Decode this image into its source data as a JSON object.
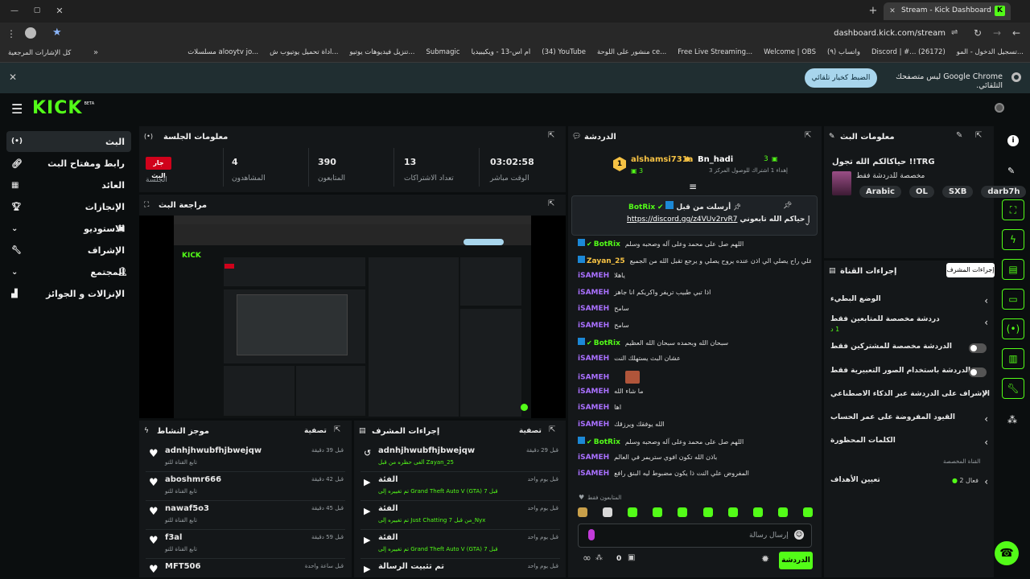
{
  "browser": {
    "tab_title": "Stream - Kick Dashboard",
    "url": "dashboard.kick.com/stream",
    "bookmarks": [
      "تسجيل الدخول - المو...",
      "Discord | #... (26172)",
      "(٩) واتساب",
      "Welcome | OBS",
      "Free Live Streaming...",
      "منشور على اللوحة ce...",
      "(34) YouTube",
      "أم أس-13 - ويكيبيديا",
      "Submagic",
      "تنزيل فيديوهات يوتيو...",
      "أداة تحميل يوتيوب ش...",
      "مسلسلات alooytv jo...",
      "كل الإشارات المرجعية"
    ],
    "info_text": "Google Chrome ليس متصفحك التلقائي.",
    "info_button": "الضبط كخيار تلقائي"
  },
  "nav": {
    "logo": "KICK",
    "logo_sup": "BETA",
    "items": [
      "البث",
      "رابط ومفتاح البث",
      "العائد",
      "الإنجازات",
      "الاستوديو",
      "الإشراف",
      "المجتمع",
      "الإنزالات و الجوائز"
    ]
  },
  "session": {
    "title": "معلومات الجلسة",
    "live_badge": "جار البث",
    "session_label": "الجلسة",
    "viewers_value": "4",
    "viewers_label": "المشاهدون",
    "followers_value": "390",
    "followers_label": "المتابعون",
    "subs_value": "13",
    "subs_label": "تعداد الاشتراكات",
    "time_value": "03:02:58",
    "time_label": "الوقت مباشر"
  },
  "preview": {
    "title": "مراجعة البث"
  },
  "activity": {
    "title": "موجز النشاط",
    "filter": "تصفية",
    "items": [
      {
        "name": "adnhjhwubfhjbwejqw",
        "sub": "تابع القناة للتو",
        "time": "قبل 39 دقيقة"
      },
      {
        "name": "aboshmr666",
        "sub": "تابع القناة للتو",
        "time": "قبل 42 دقيقة"
      },
      {
        "name": "nawaf5o3",
        "sub": "تابع القناة للتو",
        "time": "قبل 45 دقيقة"
      },
      {
        "name": "f3al",
        "sub": "تابع القناة للتو",
        "time": "قبل 59 دقيقة"
      },
      {
        "name": "MFT506",
        "sub": "",
        "time": "قبل ساعة واحدة"
      }
    ]
  },
  "modactions": {
    "title": "إجراءات المشرف",
    "filter": "تصفية",
    "items": [
      {
        "name": "adnhjhwubfhjbwejqw",
        "sub": "ألغى حظره من قبل Zayan_25",
        "time": "قبل 29 دقيقة"
      },
      {
        "name": "الفئة",
        "sub": "تم تغييره إلى Grand Theft Auto V (GTA) من قبل 7_Nyx",
        "time": "قبل يوم واحد"
      },
      {
        "name": "الفئة",
        "sub": "تم تغييره إلى Just Chatting من قبل 7_Nyx",
        "time": "قبل يوم واحد"
      },
      {
        "name": "الفئة",
        "sub": "تم تغييره إلى Grand Theft Auto V (GTA) من قبل 7_Nyx",
        "time": "قبل يوم واحد"
      },
      {
        "name": "تم تثبيت الرسالة",
        "sub": "",
        "time": "قبل يوم واحد"
      }
    ]
  },
  "chat": {
    "title": "الدردشة",
    "top_user1": "alshamsi731a",
    "top_user1_count": "3",
    "top_user2": "Bn_hadi",
    "top_user2_count": "3",
    "top_user2_sub": "إهداء 1 اشتراك للوصول المركز 3",
    "pinned_by": "أرسلت من قبل",
    "pinned_user": "BotRix",
    "pinned_text": "حياكم الله تابعوني |",
    "pinned_link": "https://discord.gg/z4VUv2rvR7",
    "messages": [
      {
        "user": "BotRix",
        "text": "اللهم صل على محمد وعلى آله وصحبه وسلم",
        "c": "#53fc18"
      },
      {
        "user": "Zayan_25",
        "text": "علي راح يصلي الي اذن عنده يروح يصلي و يرجع تقبل الله من الجميع",
        "c": "#f6c244"
      },
      {
        "user": "iSAMEH",
        "text": "ياهلا",
        "c": "#a970ff"
      },
      {
        "user": "iSAMEH",
        "text": "اذا تبي طبيب تريفر واكريكم انا جاهز",
        "c": "#a970ff"
      },
      {
        "user": "iSAMEH",
        "text": "سامح",
        "c": "#a970ff"
      },
      {
        "user": "iSAMEH",
        "text": "سامح",
        "c": "#a970ff"
      },
      {
        "user": "BotRix",
        "text": "سبحان الله وبحمده سبحان الله العظيم",
        "c": "#53fc18"
      },
      {
        "user": "iSAMEH",
        "text": "عشان البث يستهلك النت",
        "c": "#a970ff"
      },
      {
        "user": "iSAMEH",
        "text": "",
        "c": "#a970ff"
      },
      {
        "user": "iSAMEH",
        "text": "ما شاء الله",
        "c": "#a970ff"
      },
      {
        "user": "iSAMEH",
        "text": "اها",
        "c": "#a970ff"
      },
      {
        "user": "iSAMEH",
        "text": "الله يوفقك ويرزقك",
        "c": "#a970ff"
      },
      {
        "user": "BotRix",
        "text": "اللهم صل على محمد وعلى آله وصحبه وسلم",
        "c": "#53fc18"
      },
      {
        "user": "iSAMEH",
        "text": "باذن الله تكون افوي ستريمر في العالم",
        "c": "#a970ff"
      },
      {
        "user": "iSAMEH",
        "text": "المفروض علي النت ذا يكون مضبوط ليه البنق رافع",
        "c": "#a970ff"
      }
    ],
    "followers_only": "المتابعون فقط",
    "input_placeholder": "إرسال رسالة",
    "send": "الدردشة",
    "counter": "0"
  },
  "streaminfo": {
    "title": "معلومات البث",
    "stream_title": "TRG!! حياكالكم الله تجول",
    "category": "مخصصة للدردشة فقط",
    "tags": [
      "Arabic",
      "OL",
      "SXB",
      "darb7h"
    ]
  },
  "channel": {
    "title": "إجراءات القناة",
    "tooltip": "إجراءات المشرف",
    "items": [
      "الوضع البطيء",
      "دردشة مخصصة للمتابعين فقط",
      "الدردشة مخصصة للمشتركين فقط",
      "الدردشة باستخدام الصور التعبيرية فقط",
      "الإشراف على الدردشة عبر الذكاء الاصطناعي",
      "القيود المفروضة على عمر الحساب",
      "الكلمات المحظورة"
    ],
    "followers_sub": "1 د",
    "custom_label": "القناة المخصصة",
    "goals": "تعيين الأهداف",
    "goals_count": "فعال 2"
  },
  "colors": {
    "accent": "#53fc18",
    "purple": "#a970ff",
    "gold": "#f6c244"
  }
}
